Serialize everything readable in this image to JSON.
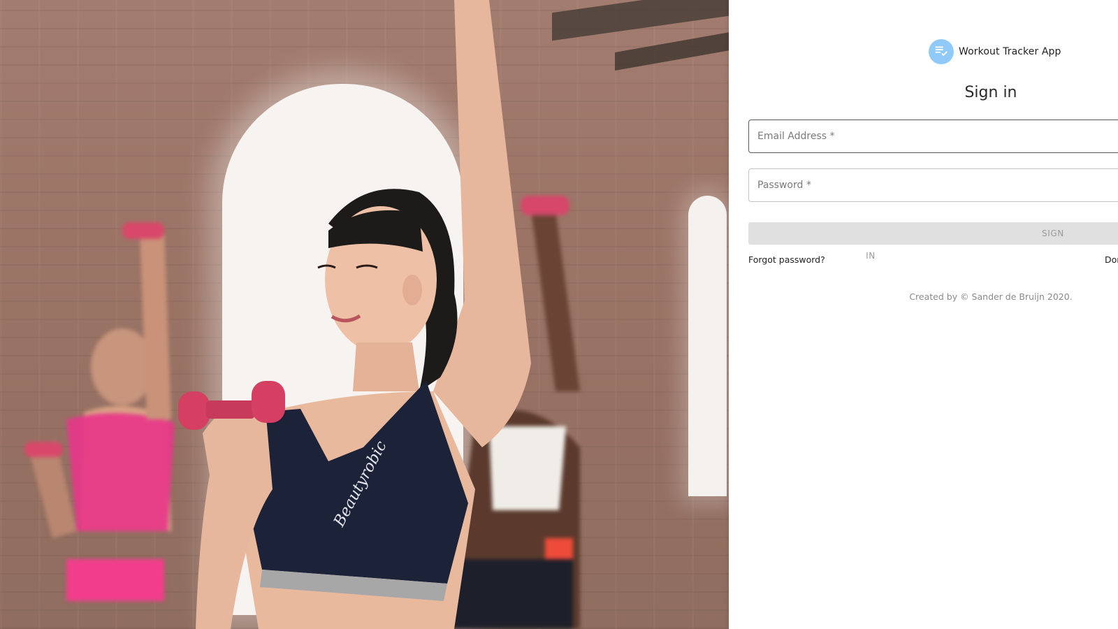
{
  "app": {
    "name": "Workout Tracker App",
    "icon": "playlist-check-icon",
    "accent_color": "#90caf9"
  },
  "hero": {
    "image": "photo of women exercising with pink dumbbells",
    "image_alt": ""
  },
  "form": {
    "title": "Sign in",
    "email_placeholder": "Email Address *",
    "email_value": "",
    "password_placeholder": "Password *",
    "password_value": "",
    "submit_label": "SIGN IN",
    "forgot_link": "Forgot password?",
    "signup_link": "Don"
  },
  "footer": {
    "text": "Created by © Sander de Bruijn 2020."
  }
}
